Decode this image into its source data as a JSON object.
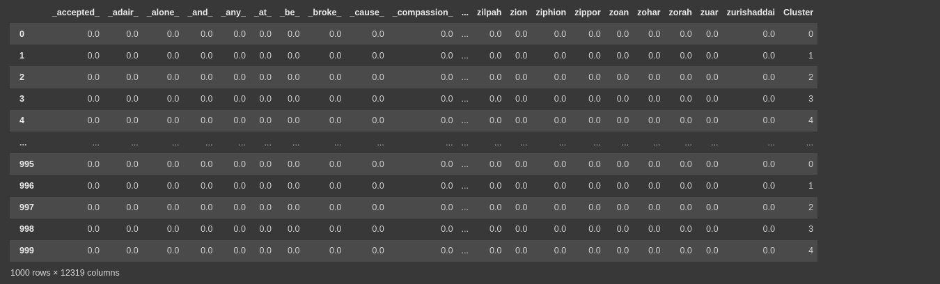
{
  "dataframe": {
    "columns": [
      "_accepted_",
      "_adair_",
      "_alone_",
      "_and_",
      "_any_",
      "_at_",
      "_be_",
      "_broke_",
      "_cause_",
      "_compassion_",
      "...",
      "zilpah",
      "zion",
      "ziphion",
      "zippor",
      "zoan",
      "zohar",
      "zorah",
      "zuar",
      "zurishaddai",
      "Cluster"
    ],
    "rows": [
      {
        "index": "0",
        "values": [
          "0.0",
          "0.0",
          "0.0",
          "0.0",
          "0.0",
          "0.0",
          "0.0",
          "0.0",
          "0.0",
          "0.0",
          "...",
          "0.0",
          "0.0",
          "0.0",
          "0.0",
          "0.0",
          "0.0",
          "0.0",
          "0.0",
          "0.0",
          "0"
        ]
      },
      {
        "index": "1",
        "values": [
          "0.0",
          "0.0",
          "0.0",
          "0.0",
          "0.0",
          "0.0",
          "0.0",
          "0.0",
          "0.0",
          "0.0",
          "...",
          "0.0",
          "0.0",
          "0.0",
          "0.0",
          "0.0",
          "0.0",
          "0.0",
          "0.0",
          "0.0",
          "1"
        ]
      },
      {
        "index": "2",
        "values": [
          "0.0",
          "0.0",
          "0.0",
          "0.0",
          "0.0",
          "0.0",
          "0.0",
          "0.0",
          "0.0",
          "0.0",
          "...",
          "0.0",
          "0.0",
          "0.0",
          "0.0",
          "0.0",
          "0.0",
          "0.0",
          "0.0",
          "0.0",
          "2"
        ]
      },
      {
        "index": "3",
        "values": [
          "0.0",
          "0.0",
          "0.0",
          "0.0",
          "0.0",
          "0.0",
          "0.0",
          "0.0",
          "0.0",
          "0.0",
          "...",
          "0.0",
          "0.0",
          "0.0",
          "0.0",
          "0.0",
          "0.0",
          "0.0",
          "0.0",
          "0.0",
          "3"
        ]
      },
      {
        "index": "4",
        "values": [
          "0.0",
          "0.0",
          "0.0",
          "0.0",
          "0.0",
          "0.0",
          "0.0",
          "0.0",
          "0.0",
          "0.0",
          "...",
          "0.0",
          "0.0",
          "0.0",
          "0.0",
          "0.0",
          "0.0",
          "0.0",
          "0.0",
          "0.0",
          "4"
        ]
      },
      {
        "index": "...",
        "values": [
          "...",
          "...",
          "...",
          "...",
          "...",
          "...",
          "...",
          "...",
          "...",
          "...",
          "...",
          "...",
          "...",
          "...",
          "...",
          "...",
          "...",
          "...",
          "...",
          "...",
          "..."
        ]
      },
      {
        "index": "995",
        "values": [
          "0.0",
          "0.0",
          "0.0",
          "0.0",
          "0.0",
          "0.0",
          "0.0",
          "0.0",
          "0.0",
          "0.0",
          "...",
          "0.0",
          "0.0",
          "0.0",
          "0.0",
          "0.0",
          "0.0",
          "0.0",
          "0.0",
          "0.0",
          "0"
        ]
      },
      {
        "index": "996",
        "values": [
          "0.0",
          "0.0",
          "0.0",
          "0.0",
          "0.0",
          "0.0",
          "0.0",
          "0.0",
          "0.0",
          "0.0",
          "...",
          "0.0",
          "0.0",
          "0.0",
          "0.0",
          "0.0",
          "0.0",
          "0.0",
          "0.0",
          "0.0",
          "1"
        ]
      },
      {
        "index": "997",
        "values": [
          "0.0",
          "0.0",
          "0.0",
          "0.0",
          "0.0",
          "0.0",
          "0.0",
          "0.0",
          "0.0",
          "0.0",
          "...",
          "0.0",
          "0.0",
          "0.0",
          "0.0",
          "0.0",
          "0.0",
          "0.0",
          "0.0",
          "0.0",
          "2"
        ]
      },
      {
        "index": "998",
        "values": [
          "0.0",
          "0.0",
          "0.0",
          "0.0",
          "0.0",
          "0.0",
          "0.0",
          "0.0",
          "0.0",
          "0.0",
          "...",
          "0.0",
          "0.0",
          "0.0",
          "0.0",
          "0.0",
          "0.0",
          "0.0",
          "0.0",
          "0.0",
          "3"
        ]
      },
      {
        "index": "999",
        "values": [
          "0.0",
          "0.0",
          "0.0",
          "0.0",
          "0.0",
          "0.0",
          "0.0",
          "0.0",
          "0.0",
          "0.0",
          "...",
          "0.0",
          "0.0",
          "0.0",
          "0.0",
          "0.0",
          "0.0",
          "0.0",
          "0.0",
          "0.0",
          "4"
        ]
      }
    ],
    "shape_text": "1000 rows × 12319 columns"
  },
  "colors": {
    "background": "#383838",
    "row_stripe": "#4a4a4a",
    "text": "#d5d5d5"
  }
}
